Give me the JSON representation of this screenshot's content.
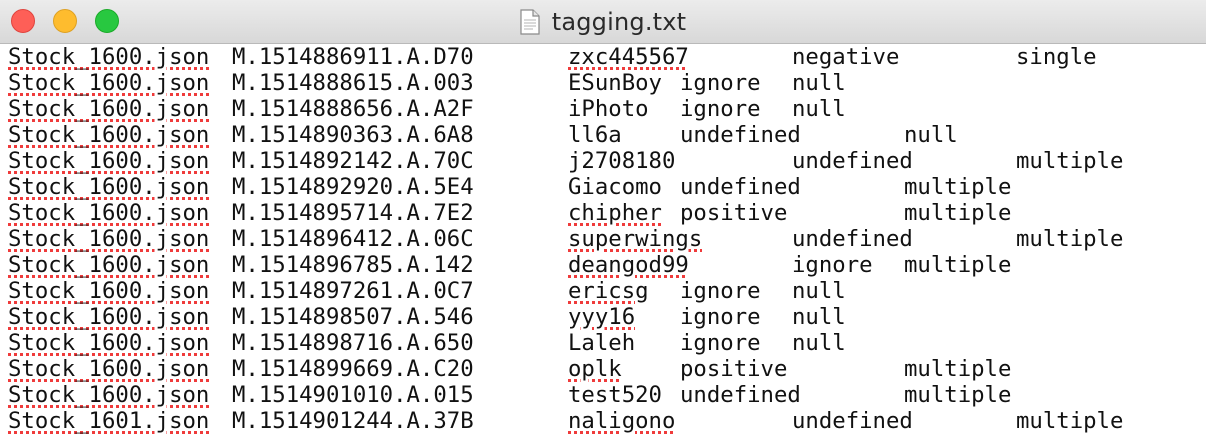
{
  "window": {
    "title": "tagging.txt",
    "file_icon": "document-icon"
  },
  "lines": [
    [
      "Stock_1600.json",
      "M.1514886911.A.D70",
      "zxc445567",
      "negative",
      "single"
    ],
    [
      "Stock_1600.json",
      "M.1514888615.A.003",
      "ESunBoy",
      "ignore",
      "null"
    ],
    [
      "Stock_1600.json",
      "M.1514888656.A.A2F",
      "iPhoto",
      "ignore",
      "null"
    ],
    [
      "Stock_1600.json",
      "M.1514890363.A.6A8",
      "ll6a",
      "undefined",
      "null"
    ],
    [
      "Stock_1600.json",
      "M.1514892142.A.70C",
      "j2708180",
      "undefined",
      "multiple"
    ],
    [
      "Stock_1600.json",
      "M.1514892920.A.5E4",
      "Giacomo",
      "undefined",
      "multiple"
    ],
    [
      "Stock_1600.json",
      "M.1514895714.A.7E2",
      "chipher",
      "positive",
      "multiple"
    ],
    [
      "Stock_1600.json",
      "M.1514896412.A.06C",
      "superwings",
      "undefined",
      "multiple"
    ],
    [
      "Stock_1600.json",
      "M.1514896785.A.142",
      "deangod99",
      "ignore",
      "multiple"
    ],
    [
      "Stock_1600.json",
      "M.1514897261.A.0C7",
      "ericsg",
      "ignore",
      "null"
    ],
    [
      "Stock_1600.json",
      "M.1514898507.A.546",
      "yyy16",
      "ignore",
      "null"
    ],
    [
      "Stock_1600.json",
      "M.1514898716.A.650",
      "Laleh",
      "ignore",
      "null"
    ],
    [
      "Stock_1600.json",
      "M.1514899669.A.C20",
      "oplk",
      "positive",
      "multiple"
    ],
    [
      "Stock_1600.json",
      "M.1514901010.A.015",
      "test520",
      "undefined",
      "multiple"
    ],
    [
      "Stock_1601.json",
      "M.1514901244.A.37B",
      "naligono",
      "undefined",
      "multiple"
    ]
  ]
}
